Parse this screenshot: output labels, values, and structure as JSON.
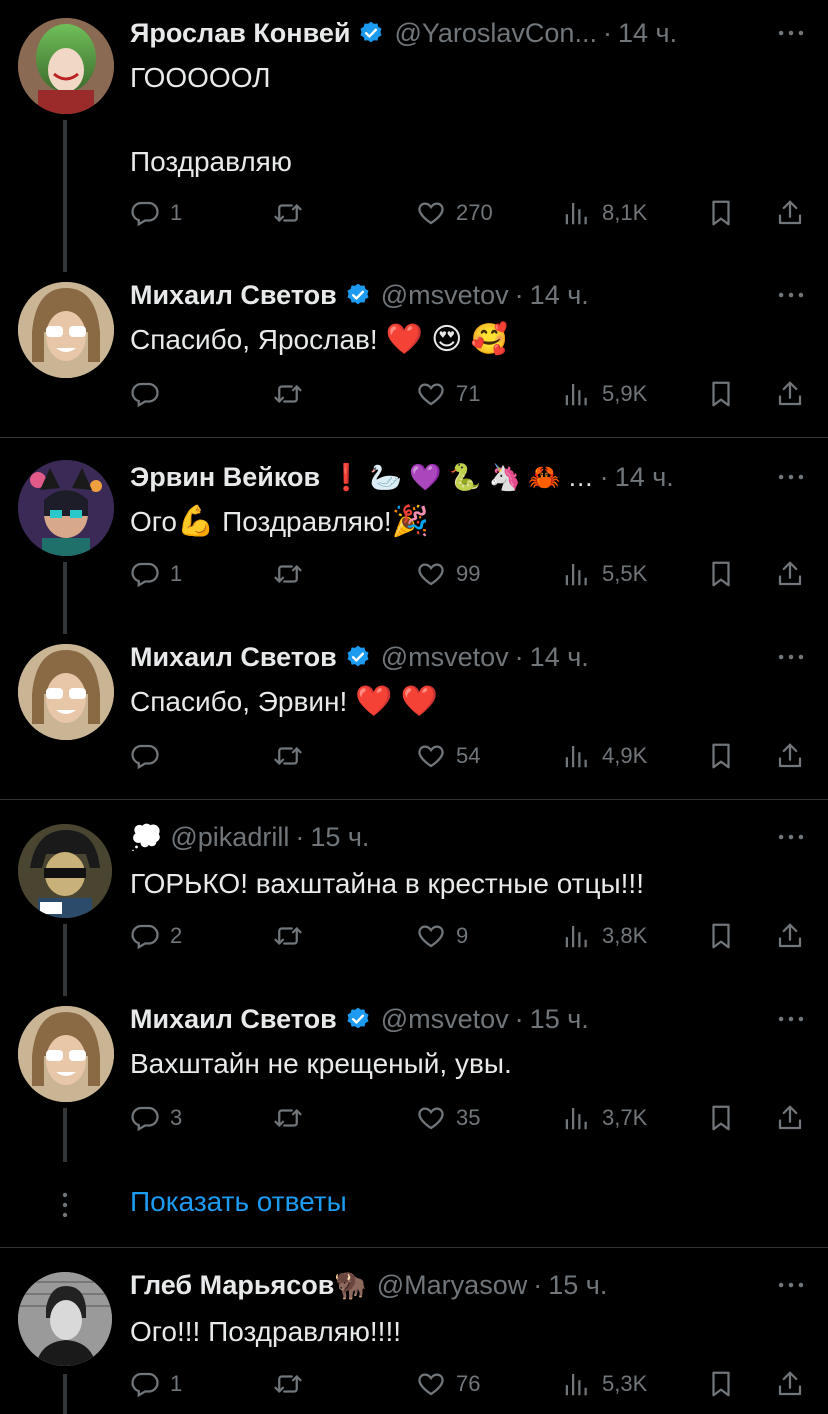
{
  "tweets": [
    {
      "name": "Ярослав Конвей",
      "handle": "@YaroslavCon...",
      "time": "14 ч.",
      "text_lines": [
        "ГОООООЛ",
        "",
        "Поздравляю"
      ],
      "replies": "1",
      "retweets": "",
      "likes": "270",
      "views": "8,1K",
      "verified": true
    },
    {
      "name": "Михаил Светов",
      "handle": "@msvetov",
      "time": "14 ч.",
      "text": "Спасибо, Ярослав!",
      "emojis": "❤️ 😍 🥰",
      "replies": "",
      "likes": "71",
      "views": "5,9K",
      "verified": true
    },
    {
      "name": "Эрвин Вейков",
      "name_emojis": "❗ 🦢 💜 🐍 🦄 🦀 …",
      "time": "14 ч.",
      "text_a": "Ого",
      "text_emoji_a": "💪",
      "text_b": "Поздравляю!",
      "text_emoji_b": "🎉",
      "replies": "1",
      "likes": "99",
      "views": "5,5K"
    },
    {
      "name": "Михаил Светов",
      "handle": "@msvetov",
      "time": "14 ч.",
      "text": "Спасибо, Эрвин!",
      "emojis": "❤️ ❤️",
      "replies": "",
      "likes": "54",
      "views": "4,9K",
      "verified": true
    },
    {
      "name_emoji": "💭",
      "handle": "@pikadrill",
      "time": "15 ч.",
      "text": "ГОРЬКО! вахштайна в крестные отцы!!!",
      "replies": "2",
      "likes": "9",
      "views": "3,8K"
    },
    {
      "name": "Михаил Светов",
      "handle": "@msvetov",
      "time": "15 ч.",
      "text": "Вахштайн не крещеный, увы.",
      "replies": "3",
      "likes": "35",
      "views": "3,7K",
      "verified": true
    },
    {
      "name": "Глеб Марьясов",
      "name_emoji": "🦬",
      "handle": "@Maryasow",
      "time": "15 ч.",
      "text": "Ого!!! Поздравляю!!!!",
      "replies": "1",
      "likes": "76",
      "views": "5,3K"
    }
  ],
  "show_replies": "Показать ответы",
  "dot_sep": "·",
  "colors": {
    "bg": "#000000",
    "text": "#e7e9ea",
    "muted": "#71767b",
    "accent": "#1d9bf0",
    "divider": "#2f3336"
  }
}
